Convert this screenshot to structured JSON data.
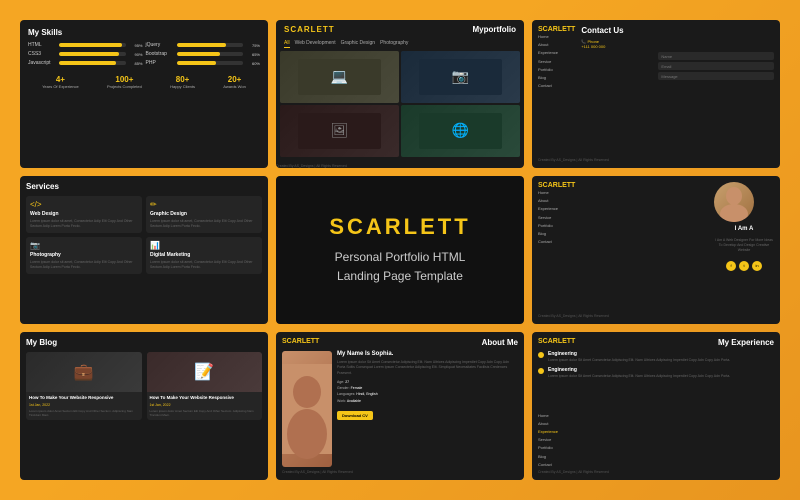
{
  "meta": {
    "brand": "SCARLETT",
    "template_name": "Personal Portfolio HTML Landing Page Template",
    "credit": "Created By AS_Designs |",
    "rights": "All Rights Reserved"
  },
  "nav": {
    "items": [
      "Home",
      "About",
      "Experience",
      "Service",
      "Portfolio",
      "Blog",
      "Contact"
    ]
  },
  "skills": {
    "title": "My Skills",
    "left": [
      {
        "name": "HTML",
        "pct": 95,
        "label": "95%"
      },
      {
        "name": "CSS3",
        "pct": 90,
        "label": "90%"
      },
      {
        "name": "Javascript",
        "pct": 85,
        "label": "85%"
      }
    ],
    "right": [
      {
        "name": "jQuery",
        "pct": 75,
        "label": "75%"
      },
      {
        "name": "Bootstrap",
        "pct": 65,
        "label": "65%"
      },
      {
        "name": "PHP",
        "pct": 60,
        "label": "60%"
      }
    ],
    "stats": [
      {
        "num": "4+",
        "label": "Years Of Experience"
      },
      {
        "num": "100+",
        "label": "Projects Completed"
      },
      {
        "num": "80+",
        "label": "Happy Clients"
      },
      {
        "num": "20+",
        "label": "Awards Won"
      }
    ]
  },
  "portfolio": {
    "title": "Myportfolio",
    "tabs": [
      "All",
      "Web Development",
      "Graphic Design",
      "Photography"
    ]
  },
  "contact": {
    "title": "Contact Us",
    "phone_label": "Phone",
    "phone": "+111 000 000",
    "inputs": [
      "Name",
      "Email",
      "Message"
    ]
  },
  "services": {
    "title": "Services",
    "items": [
      {
        "icon": "</>",
        "name": "Web Design",
        "desc": "Lorem ipsum dolor sit amet, Consectetur Adip Elit Copy And Other Sectum Adip Lorem Porta Fecto."
      },
      {
        "icon": "✏",
        "name": "Graphic Design",
        "desc": "Lorem ipsum dolor sit amet, Consectetur Adip Elit Copy And Other Sectum Adip Lorem Porta Fecto."
      },
      {
        "icon": "📷",
        "name": "Photography",
        "desc": "Lorem ipsum dolor sit amet, Consectetur Adip Elit Copy And Other Sectum Adip Lorem Porta Fecto."
      },
      {
        "icon": "📊",
        "name": "Digital Marketing",
        "desc": "Lorem ipsum dolor sit amet, Consectetur Adip Elit Copy And Other Sectum Adip Lorem Porta Fecto."
      }
    ]
  },
  "center": {
    "brand": "SCARLETT",
    "subtitle_line1": "Personal Portfolio HTML",
    "subtitle_line2": "Landing Page Template"
  },
  "about_portrait": {
    "iam": "I Am A",
    "desc": "I Am A Web Designer For More Ideas To Develop And Design Creative Website",
    "socials": [
      "f",
      "t",
      "in"
    ]
  },
  "blog": {
    "title": "My Blog",
    "posts": [
      {
        "title": "How To Make Your Website Responsive",
        "date": "1st Jan, 2022",
        "desc": "Lorem ipsum dolor Amet Sectum Elit Copy And Other Sectum. Adipiscing Nam Tincidunt Maci."
      },
      {
        "title": "How To Make Your Website Responsive",
        "date": "1st Jan, 2022",
        "desc": "Lorem ipsum dolor Amet Sectum Elit Copy And Other Sectum. Adipiscing Nam Tincidunt Maci."
      }
    ]
  },
  "about_me": {
    "title": "About Me",
    "name": "My Name Is Sophia.",
    "desc": "Lorem ipsum dolor Sit Amet Consectetur Adipiscing Elit. Nam Ultrices Adipiscing Imperdiet Copy Adn Copy Adn Porta Soltis Consequat Lorem Ipsum Consectetur Adipiscing Elit. Simpliquat Necessitates Facilisis Credences Praesent.",
    "details": [
      {
        "label": "Age:",
        "value": "27"
      },
      {
        "label": "Gender:",
        "value": "Female"
      },
      {
        "label": "Languages:",
        "value": "Hindi, English"
      },
      {
        "label": "Work:",
        "value": "Available"
      }
    ],
    "download_label": "Download CV"
  },
  "experience": {
    "title": "My Experience",
    "items": [
      {
        "role": "Engineering",
        "desc": "Lorem ipsum dolor Sit Amet Consectetur Adipiscing Elit. Nam Ultrices Adipiscing Imperdiet Copy Adn Copy Adn Porta."
      },
      {
        "role": "Engineering",
        "desc": "Lorem ipsum dolor Sit Amet Consectetur Adipiscing Elit. Nam Ultrices Adipiscing Imperdiet Copy Adn Copy Adn Porta."
      }
    ]
  }
}
